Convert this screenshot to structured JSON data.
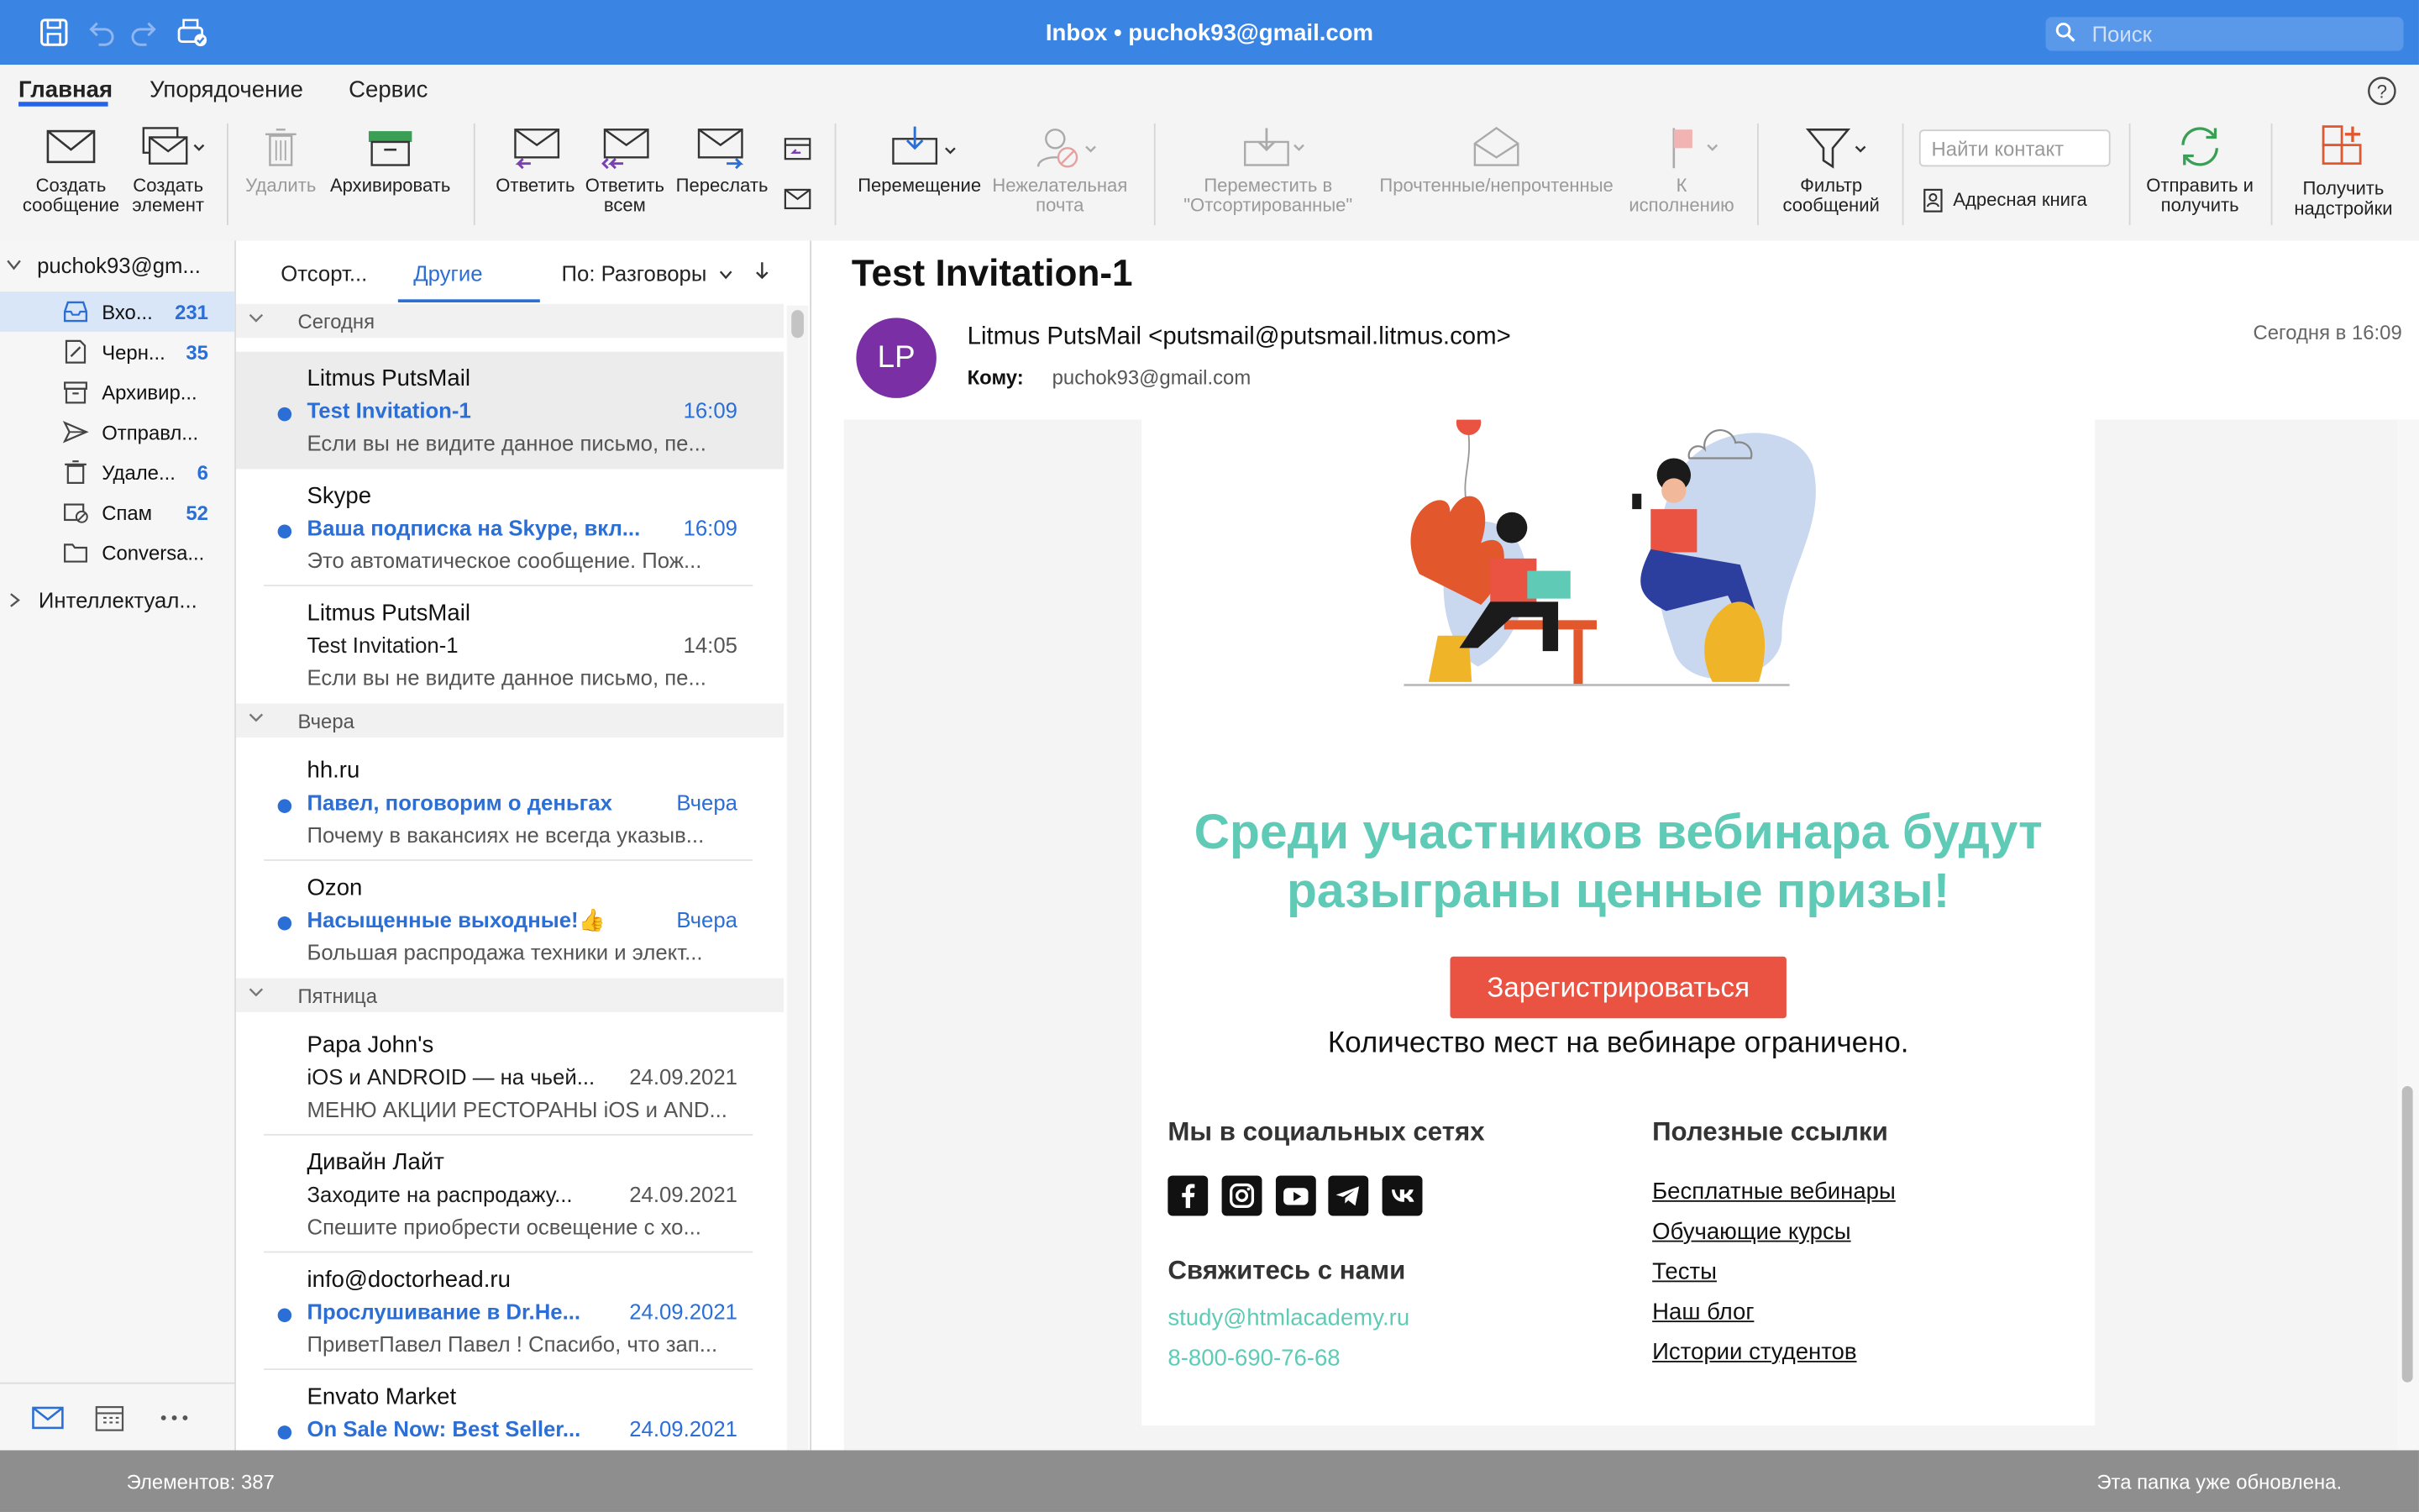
{
  "window": {
    "title": "Inbox • puchok93@gmail.com",
    "search_placeholder": "Поиск"
  },
  "menu": {
    "items": [
      "Главная",
      "Упорядочение",
      "Сервис"
    ]
  },
  "ribbon": {
    "new_message": "Создать сообщение",
    "new_item": "Создать элемент",
    "delete": "Удалить",
    "archive": "Архивировать",
    "reply": "Ответить",
    "reply_all": "Ответить всем",
    "forward": "Переслать",
    "move": "Перемещение",
    "junk": "Нежелательная почта",
    "move_focused": "Переместить в \"Отсортированные\"",
    "read_unread": "Прочтенные/непрочтенные",
    "followup": "К исполнению",
    "filter": "Фильтр сообщений",
    "find_contact_placeholder": "Найти контакт",
    "address_book": "Адресная книга",
    "send_receive": "Отправить и получить",
    "get_addins": "Получить надстройки"
  },
  "folders": {
    "account": "puchok93@gm...",
    "items": [
      {
        "label": "Вхо...",
        "count": "231",
        "icon": "inbox-icon"
      },
      {
        "label": "Черн...",
        "count": "35",
        "icon": "drafts-icon"
      },
      {
        "label": "Архивир...",
        "count": "",
        "icon": "archive-icon"
      },
      {
        "label": "Отправл...",
        "count": "",
        "icon": "sent-icon"
      },
      {
        "label": "Удале...",
        "count": "6",
        "icon": "trash-icon"
      },
      {
        "label": "Спам",
        "count": "52",
        "icon": "junk-icon"
      },
      {
        "label": "Conversa...",
        "count": "",
        "icon": "folder-icon"
      }
    ],
    "smart": "Интеллектуал..."
  },
  "list": {
    "tabs": {
      "focused": "Отсорт...",
      "other": "Другие"
    },
    "sort": "По: Разговоры",
    "groups": {
      "today": "Сегодня",
      "yesterday": "Вчера",
      "friday": "Пятница"
    },
    "messages": [
      {
        "sender": "Litmus PutsMail",
        "subject": "Test Invitation-1",
        "time": "16:09",
        "preview": "Если вы не видите данное письмо, пе..."
      },
      {
        "sender": "Skype",
        "subject": "Ваша подписка на Skype, вкл...",
        "time": "16:09",
        "preview": "Это автоматическое сообщение. Пож..."
      },
      {
        "sender": "Litmus PutsMail",
        "subject": "Test Invitation-1",
        "time": "14:05",
        "preview": "Если вы не видите данное письмо, пе..."
      },
      {
        "sender": "hh.ru",
        "subject": "Павел, поговорим о деньгах",
        "time": "Вчера",
        "preview": "Почему в вакансиях не всегда указыв..."
      },
      {
        "sender": "Ozon",
        "subject": "Насыщенные выходные!👍",
        "time": "Вчера",
        "preview": "Большая распродажа техники и элект..."
      },
      {
        "sender": "Papa John's",
        "subject": "iOS и ANDROID — на чьей...",
        "time": "24.09.2021",
        "preview": "МЕНЮ АКЦИИ РЕСТОРАНЫ iOS и AND..."
      },
      {
        "sender": "Дивайн Лайт",
        "subject": "Заходите на распродажу...",
        "time": "24.09.2021",
        "preview": "Спешите приобрести освещение с хо..."
      },
      {
        "sender": "info@doctorhead.ru",
        "subject": "Прослушивание в Dr.He...",
        "time": "24.09.2021",
        "preview": "ПриветПавел Павел ! Спасибо, что зап..."
      },
      {
        "sender": "Envato Market",
        "subject": "On Sale Now: Best Seller...",
        "time": "24.09.2021",
        "preview": ""
      }
    ]
  },
  "reading": {
    "subject": "Test Invitation-1",
    "avatar": "LP",
    "from": "Litmus PutsMail <putsmail@putsmail.litmus.com>",
    "to_label": "Кому:",
    "to": "puchok93@gmail.com",
    "date": "Сегодня в 16:09",
    "email": {
      "headline": "Среди участников вебинара будут разыграны ценные призы!",
      "cta": "Зарегистрироваться",
      "limit": "Количество мест на вебинаре ограничено.",
      "social_heading": "Мы в социальных сетях",
      "contact_heading": "Свяжитесь с нами",
      "contact_email": "study@htmlacademy.ru",
      "contact_phone": "8-800-690-76-68",
      "links_heading": "Полезные ссылки",
      "links": [
        "Бесплатные вебинары",
        "Обучающие курсы",
        "Тесты",
        "Наш блог",
        "Истории студентов"
      ]
    }
  },
  "status": {
    "left": "Элементов: 387",
    "right": "Эта папка уже обновлена."
  },
  "colors": {
    "titlebar": "#3a84e4",
    "accent": "#2b6fd6",
    "headline": "#5fcbb7",
    "cta": "#ea5242",
    "avatar": "#7b2fa5"
  }
}
